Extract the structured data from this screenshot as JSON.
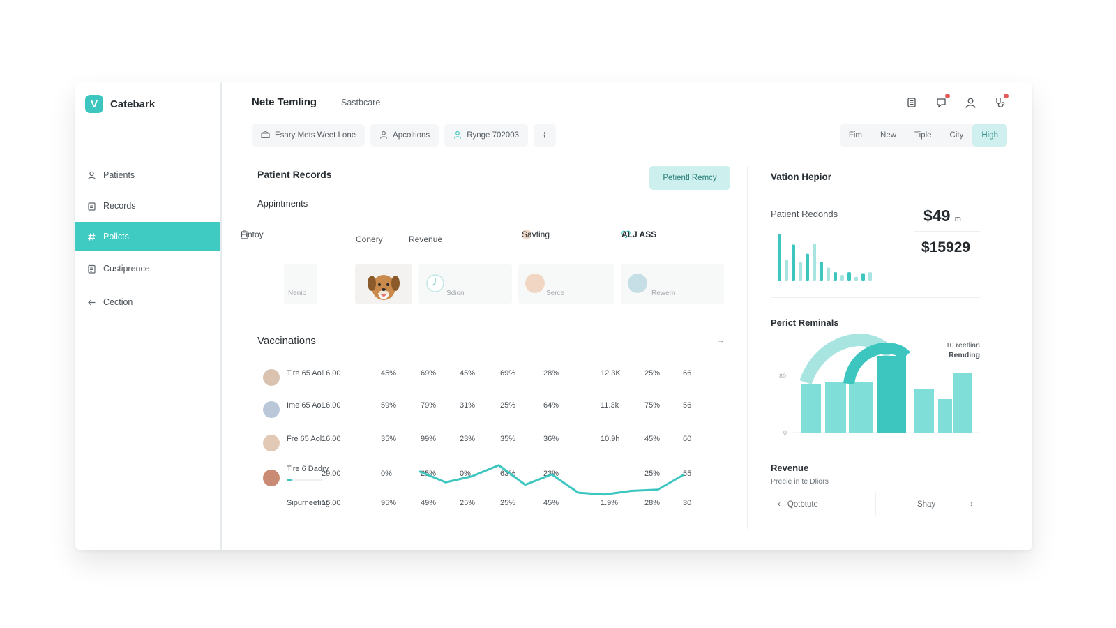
{
  "app": {
    "logo_letter": "V",
    "name": "Catebark"
  },
  "sidebar": {
    "items": [
      {
        "label": "Patients",
        "icon": "person-icon",
        "active": false
      },
      {
        "label": "Records",
        "icon": "clipboard-icon",
        "active": false
      },
      {
        "label": "Policts",
        "icon": "hash-icon",
        "active": true
      },
      {
        "label": "Custiprence",
        "icon": "document-icon",
        "active": false
      },
      {
        "label": "Cection",
        "icon": "arrow-left-icon",
        "active": false
      }
    ]
  },
  "header": {
    "title": "Nete Temling",
    "subtitle": "Sastbcare",
    "icons": [
      "notes-icon",
      "bell-icon",
      "user-icon",
      "stethoscope-icon"
    ]
  },
  "chips": [
    {
      "label": "Esary Mets Weet Lone",
      "icon": "box-icon"
    },
    {
      "label": "Apcoltions",
      "icon": "user-icon"
    },
    {
      "label": "Rynge 702003",
      "icon": "user-icon"
    },
    {
      "label": "⌇",
      "icon": ""
    }
  ],
  "segments": [
    {
      "label": "Fim",
      "active": false
    },
    {
      "label": "New",
      "active": false
    },
    {
      "label": "Tiple",
      "active": false
    },
    {
      "label": "City",
      "active": false
    },
    {
      "label": "High",
      "active": true
    }
  ],
  "patient_records": {
    "title": "Patient Records",
    "button": "Petientl Remcy",
    "subtitle": "Appintments",
    "filters": [
      "Fintoy",
      "Conery",
      "Revenue",
      "Savfing",
      "ALJ ASS"
    ],
    "cards": [
      {
        "label": "Nenio"
      },
      {
        "label": ""
      },
      {
        "label": "Sdion"
      },
      {
        "label": "Serce"
      },
      {
        "label": "Rewern"
      }
    ]
  },
  "vaccinations": {
    "title": "Vaccinations",
    "arrow": "→",
    "rows": [
      {
        "name": "Tire 65 Aol",
        "v": [
          "16.00",
          "45%",
          "69%",
          "45%",
          "69%",
          "28%",
          "12.3K",
          "25%",
          "66"
        ]
      },
      {
        "name": "Ime 65 Aol",
        "v": [
          "16.00",
          "59%",
          "79%",
          "31%",
          "25%",
          "64%",
          "11.3k",
          "75%",
          "56"
        ]
      },
      {
        "name": "Fre 65 Aol",
        "v": [
          "16.00",
          "35%",
          "99%",
          "23%",
          "35%",
          "36%",
          "10.9h",
          "45%",
          "60"
        ]
      },
      {
        "name": "Tire 6 Dadry",
        "v": [
          "29.00",
          "0%",
          "25%",
          "0%",
          "63%",
          "23%",
          "",
          "25%",
          "55"
        ]
      },
      {
        "name": "Sipurneefing",
        "v": [
          "16.00",
          "95%",
          "49%",
          "25%",
          "25%",
          "45%",
          "1.9%",
          "28%",
          "30"
        ]
      }
    ],
    "trend": {
      "y": [
        60,
        42,
        52,
        70,
        38,
        55,
        25,
        22,
        28,
        30,
        55
      ],
      "color": "#3cc6bf"
    }
  },
  "side": {
    "title": "Vation Hepior",
    "stat_label": "Patient Redonds",
    "stat_value": "$49",
    "stat_unit": "m",
    "stat_value2": "$15929",
    "mini_bars": [
      100,
      45,
      78,
      40,
      58,
      80,
      40,
      28,
      18,
      12,
      18,
      8,
      16,
      18
    ],
    "chart_title": "Perict Reminals",
    "chart_annot1": "10 reetlian",
    "chart_annot2": "Remding",
    "chart_ytick_top": "80",
    "chart_ytick_bottom": "0",
    "chart_bars": [
      70,
      72,
      72,
      110,
      62,
      48,
      85
    ],
    "revenue_title": "Revenue",
    "revenue_sub": "Preele in te Dliors",
    "pager_left": "Qotbtute",
    "pager_right": "Shay",
    "accent": "#3cc6bf"
  }
}
